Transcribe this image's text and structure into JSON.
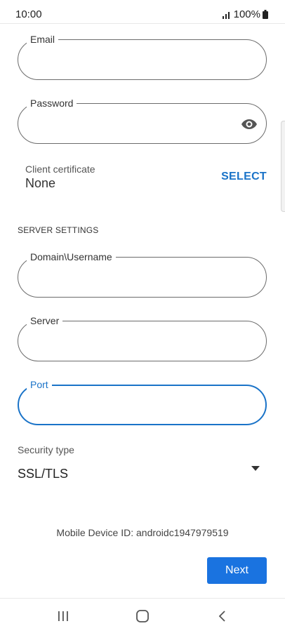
{
  "status_bar": {
    "time": "10:00",
    "battery": "100%",
    "icons": [
      "signal-icon",
      "battery-icon"
    ]
  },
  "form": {
    "email": {
      "label": "Email",
      "value": ""
    },
    "password": {
      "label": "Password",
      "value": "",
      "icon": "eye-icon"
    },
    "client_certificate": {
      "label": "Client certificate",
      "value": "None",
      "action": "SELECT"
    },
    "server_settings": {
      "header": "SERVER SETTINGS",
      "domain_username": {
        "label": "Domain\\Username",
        "value": ""
      },
      "server": {
        "label": "Server",
        "value": ""
      },
      "port": {
        "label": "Port",
        "value": ""
      },
      "security_type": {
        "label": "Security type",
        "value": "SSL/TLS",
        "icon": "dropdown-arrow-icon"
      }
    }
  },
  "device_id_text": "Mobile Device ID: androidc1947979519",
  "next_button": "Next",
  "nav_bar": {
    "icons": [
      "recent-apps-icon",
      "home-icon",
      "back-icon"
    ]
  },
  "colors": {
    "accent": "#1a73c8",
    "button": "#1a73e0",
    "border": "#6b6b6b"
  }
}
